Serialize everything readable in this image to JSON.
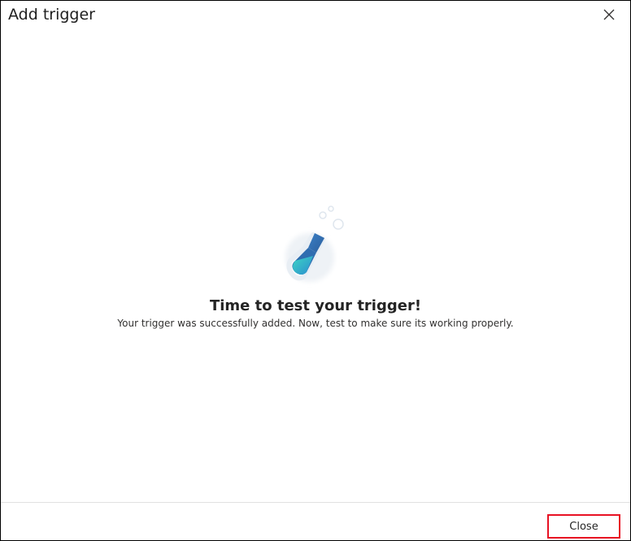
{
  "dialog": {
    "title": "Add trigger",
    "close_icon": "close-icon"
  },
  "illustration": {
    "icon": "flask-icon",
    "colors": {
      "liquid_top": "#3ec3c3",
      "liquid_bottom": "#2a86c9",
      "body": "#3d6fb0",
      "bubble": "#e6eef5"
    }
  },
  "main": {
    "heading": "Time to test your trigger!",
    "message": "Your trigger was successfully added. Now, test to make sure its working properly."
  },
  "footer": {
    "close_label": "Close",
    "highlight_color": "#e81123"
  }
}
